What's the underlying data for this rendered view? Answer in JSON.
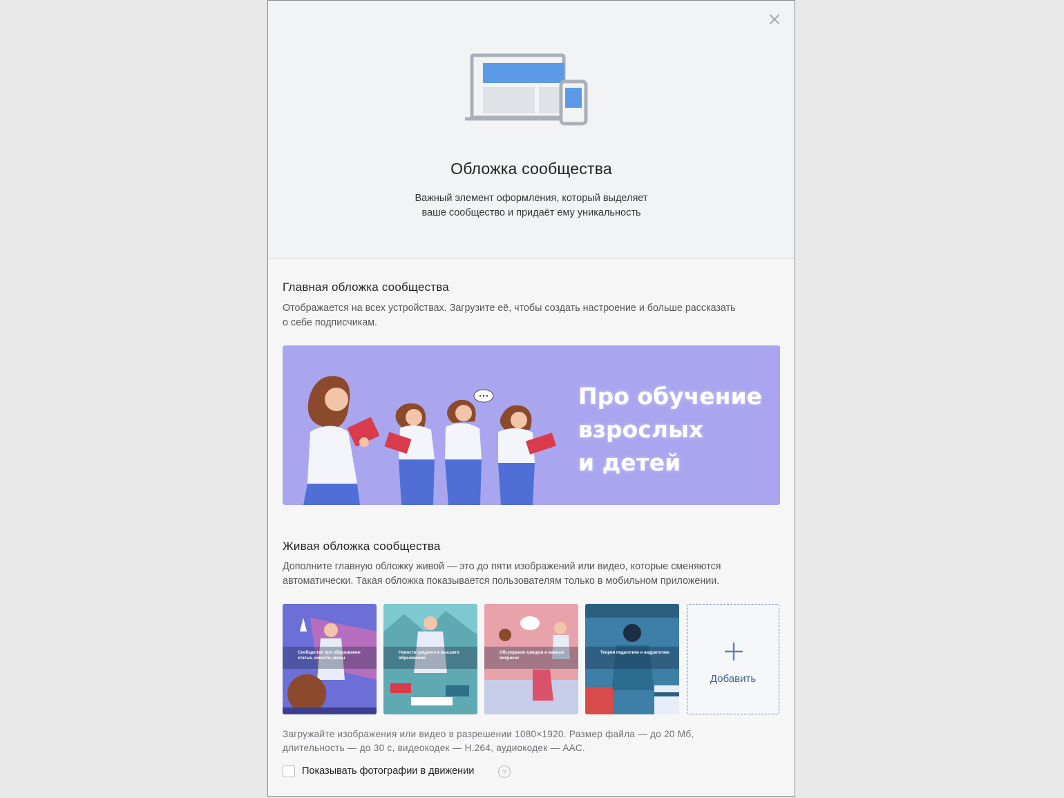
{
  "dialog": {
    "title": "Обложка сообщества",
    "subtitle_line1": "Важный элемент оформления, который выделяет",
    "subtitle_line2": "ваше сообщество и придаёт ему уникальность"
  },
  "main_cover": {
    "title": "Главная обложка сообщества",
    "desc_line1": "Отображается на всех устройствах. Загрузите её, чтобы создать настроение и больше рассказать",
    "desc_line2": "о себе подписчикам.",
    "heading_lines": [
      "Про обучение",
      "взрослых",
      "и детей"
    ]
  },
  "live_cover": {
    "title": "Живая обложка сообщества",
    "desc_line1": "Дополните главную обложку живой — это до пяти изображений или видео, которые сменяются",
    "desc_line2": "автоматически. Такая обложка показывается пользователям только в мобильном приложении.",
    "thumbnails": [
      {
        "caption": "Сообщество про образование: статьи, новости, мемы",
        "color": "#6b6fd6"
      },
      {
        "caption": "Новости среднего и высшего образования",
        "color": "#7ec8cf"
      },
      {
        "caption": "Обсуждение трендов в важных вопросах",
        "color": "#e8a3aa"
      },
      {
        "caption": "Теория педагогики и андрагогики",
        "color": "#3d7fa6"
      }
    ],
    "add_label": "Добавить"
  },
  "upload_hint": {
    "line1": "Загружайте изображения или видео в разрешении 1080×1920. Размер файла — до 20 Мб,",
    "line2": "длительность — до 30 с, видеокодек — H.264, аудиокодек — AAC."
  },
  "motion_checkbox": {
    "label": "Показывать фотографии в движении",
    "checked": false
  },
  "icons": {
    "close": "close-icon",
    "devices": "devices-icon",
    "plus": "plus-icon",
    "help": "question-icon"
  },
  "colors": {
    "accent": "#5b9ae6",
    "cover_background": "#a9a6ef",
    "dashed_border": "#5c7fb6"
  }
}
